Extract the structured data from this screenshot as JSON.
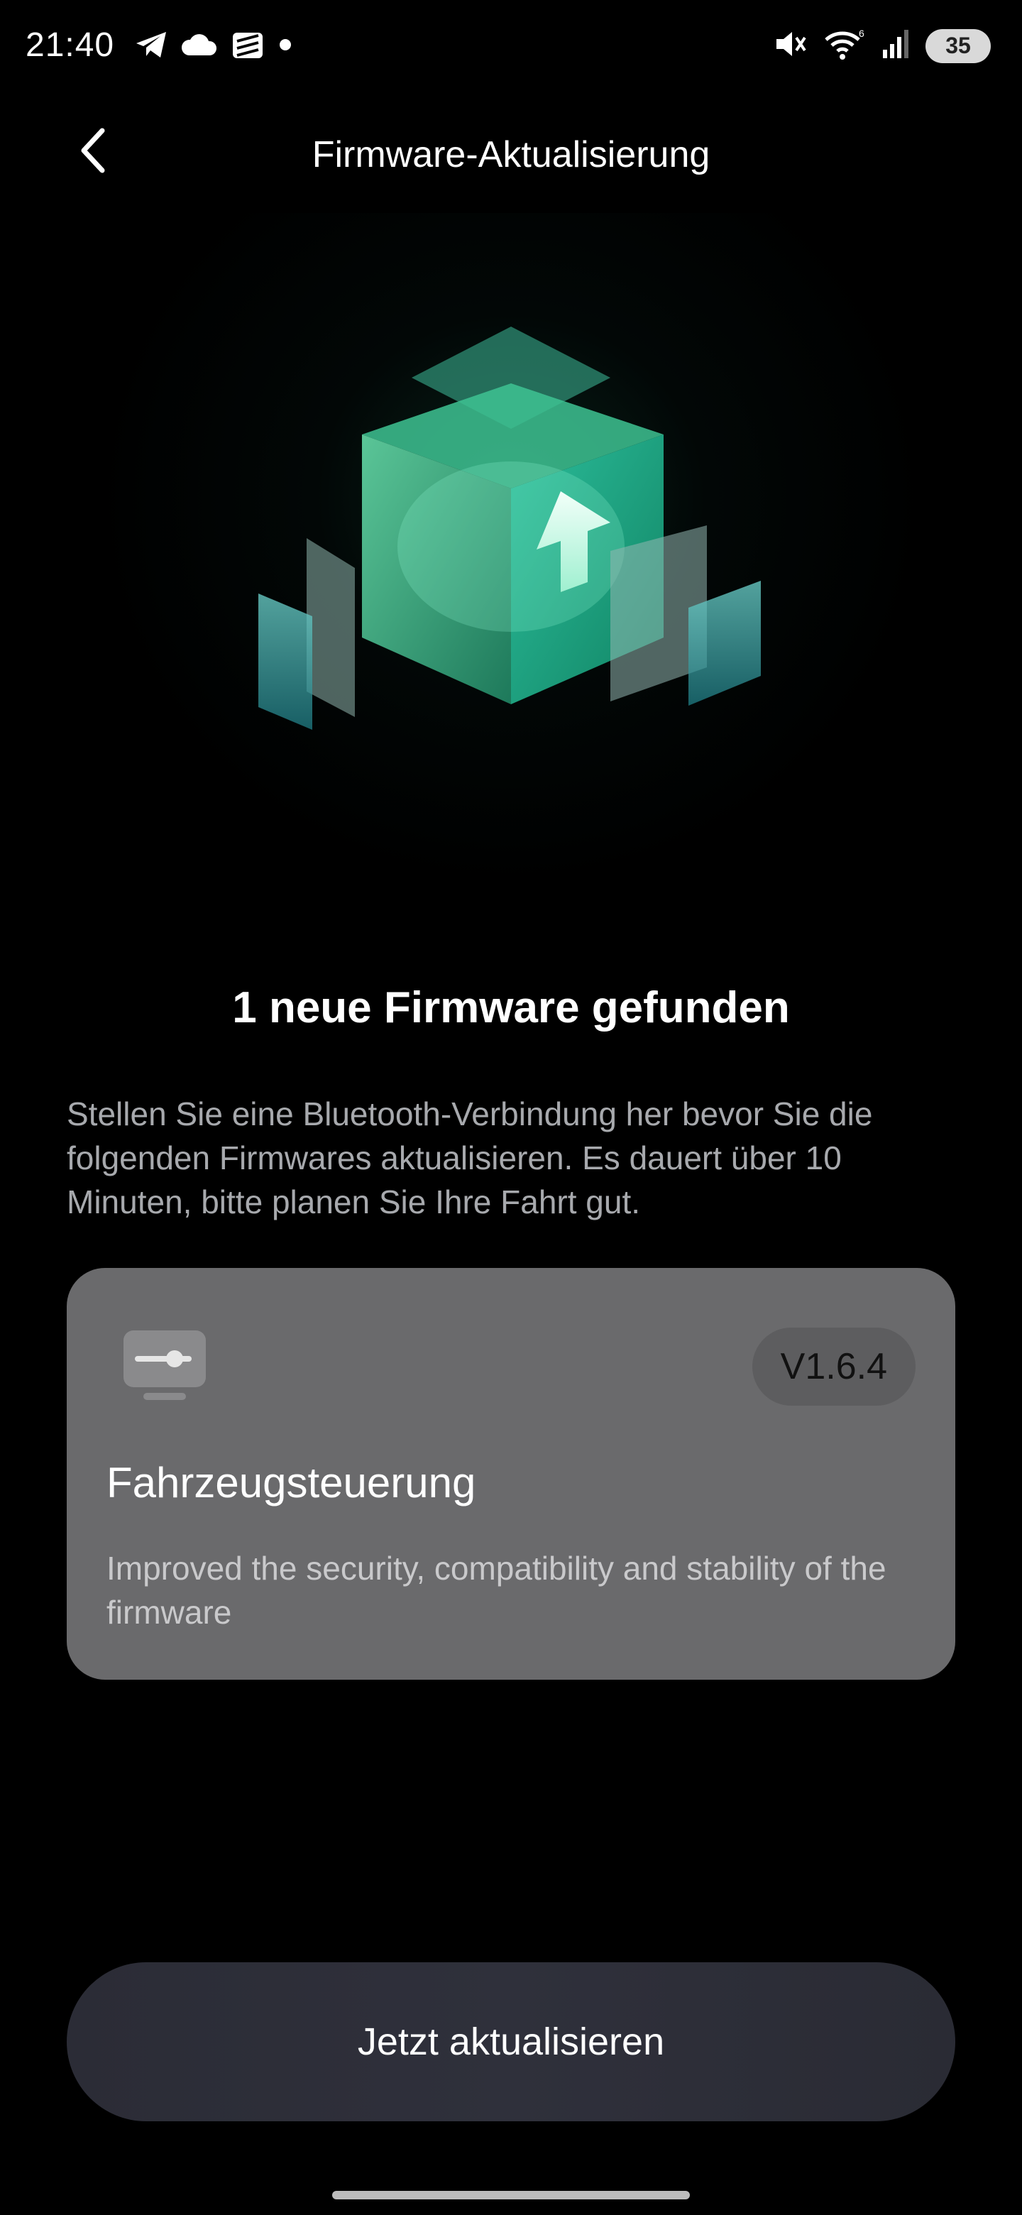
{
  "status_bar": {
    "time": "21:40",
    "battery": "35",
    "left_icons": [
      "telegram-icon",
      "cloud-icon",
      "app-icon",
      "dot-icon"
    ],
    "right_icons": [
      "mute-icon",
      "wifi-icon",
      "signal-icon",
      "battery-icon"
    ]
  },
  "header": {
    "title": "Firmware-Aktualisierung",
    "back_icon": "chevron-left-icon"
  },
  "hero": {
    "icon": "firmware-cube-upgrade-illustration"
  },
  "main": {
    "heading": "1 neue Firmware gefunden",
    "description": "Stellen Sie eine Bluetooth-Verbindung her bevor Sie die folgenden Firmwares aktualisieren. Es dauert über 10 Minuten, bitte planen Sie Ihre Fahrt gut."
  },
  "firmware_card": {
    "version": "V1.6.4",
    "title": "Fahrzeugsteuerung",
    "description": " Improved the security, compatibility and stability of the firmware",
    "icon": "vehicle-control-icon"
  },
  "actions": {
    "update_label": "Jetzt aktualisieren"
  },
  "colors": {
    "background": "#000000",
    "card": "#6a6a6c",
    "accent_green": "#2fe0a0",
    "button": "#2e2f39"
  }
}
